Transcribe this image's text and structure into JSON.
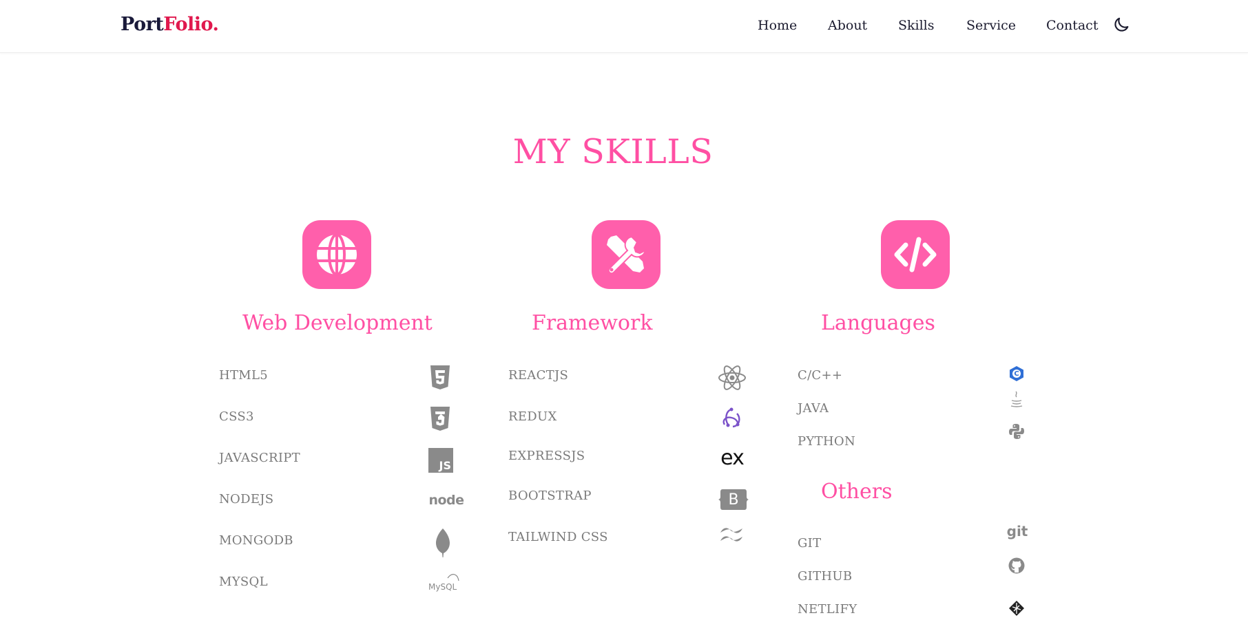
{
  "brand": {
    "part1": "Port",
    "part2": "Folio."
  },
  "nav": {
    "home": "Home",
    "about": "About",
    "skills": "Skills",
    "service": "Service",
    "contact": "Contact"
  },
  "theme_toggle_icon": "moon-icon",
  "accent_color": "#ff4fa3",
  "section_title": "MY SKILLS",
  "categories": {
    "web": {
      "title": "Web Development",
      "icon": "globe-icon",
      "skills": [
        {
          "label": "HTML5",
          "icon": "html5-icon"
        },
        {
          "label": "CSS3",
          "icon": "css3-icon"
        },
        {
          "label": "JAVASCRIPT",
          "icon": "javascript-icon"
        },
        {
          "label": "NODEJS",
          "icon": "nodejs-icon"
        },
        {
          "label": "MONGODB",
          "icon": "mongodb-icon"
        },
        {
          "label": "MYSQL",
          "icon": "mysql-icon"
        }
      ]
    },
    "framework": {
      "title": "Framework",
      "icon": "tools-icon",
      "skills": [
        {
          "label": "REACTJS",
          "icon": "react-icon"
        },
        {
          "label": "REDUX",
          "icon": "redux-icon"
        },
        {
          "label": "EXPRESSJS",
          "icon": "express-icon"
        },
        {
          "label": "BOOTSTRAP",
          "icon": "bootstrap-icon"
        },
        {
          "label": "TAILWIND CSS",
          "icon": "tailwind-icon"
        }
      ]
    },
    "languages": {
      "title": "Languages",
      "icon": "code-icon",
      "skills": [
        {
          "label": "C/C++",
          "icon": "cpp-icon"
        },
        {
          "label": "JAVA",
          "icon": "java-icon"
        },
        {
          "label": "PYTHON",
          "icon": "python-icon"
        }
      ]
    },
    "others": {
      "title": "Others",
      "skills": [
        {
          "label": "GIT",
          "icon": "git-icon"
        },
        {
          "label": "GITHUB",
          "icon": "github-icon"
        },
        {
          "label": "NETLIFY",
          "icon": "netlify-icon"
        }
      ]
    }
  },
  "icon_text": {
    "js": "JS",
    "node": "node",
    "mysql": "MySQL",
    "bootstrap": "B",
    "express": "ex",
    "git": "git",
    "cpp": "C"
  }
}
